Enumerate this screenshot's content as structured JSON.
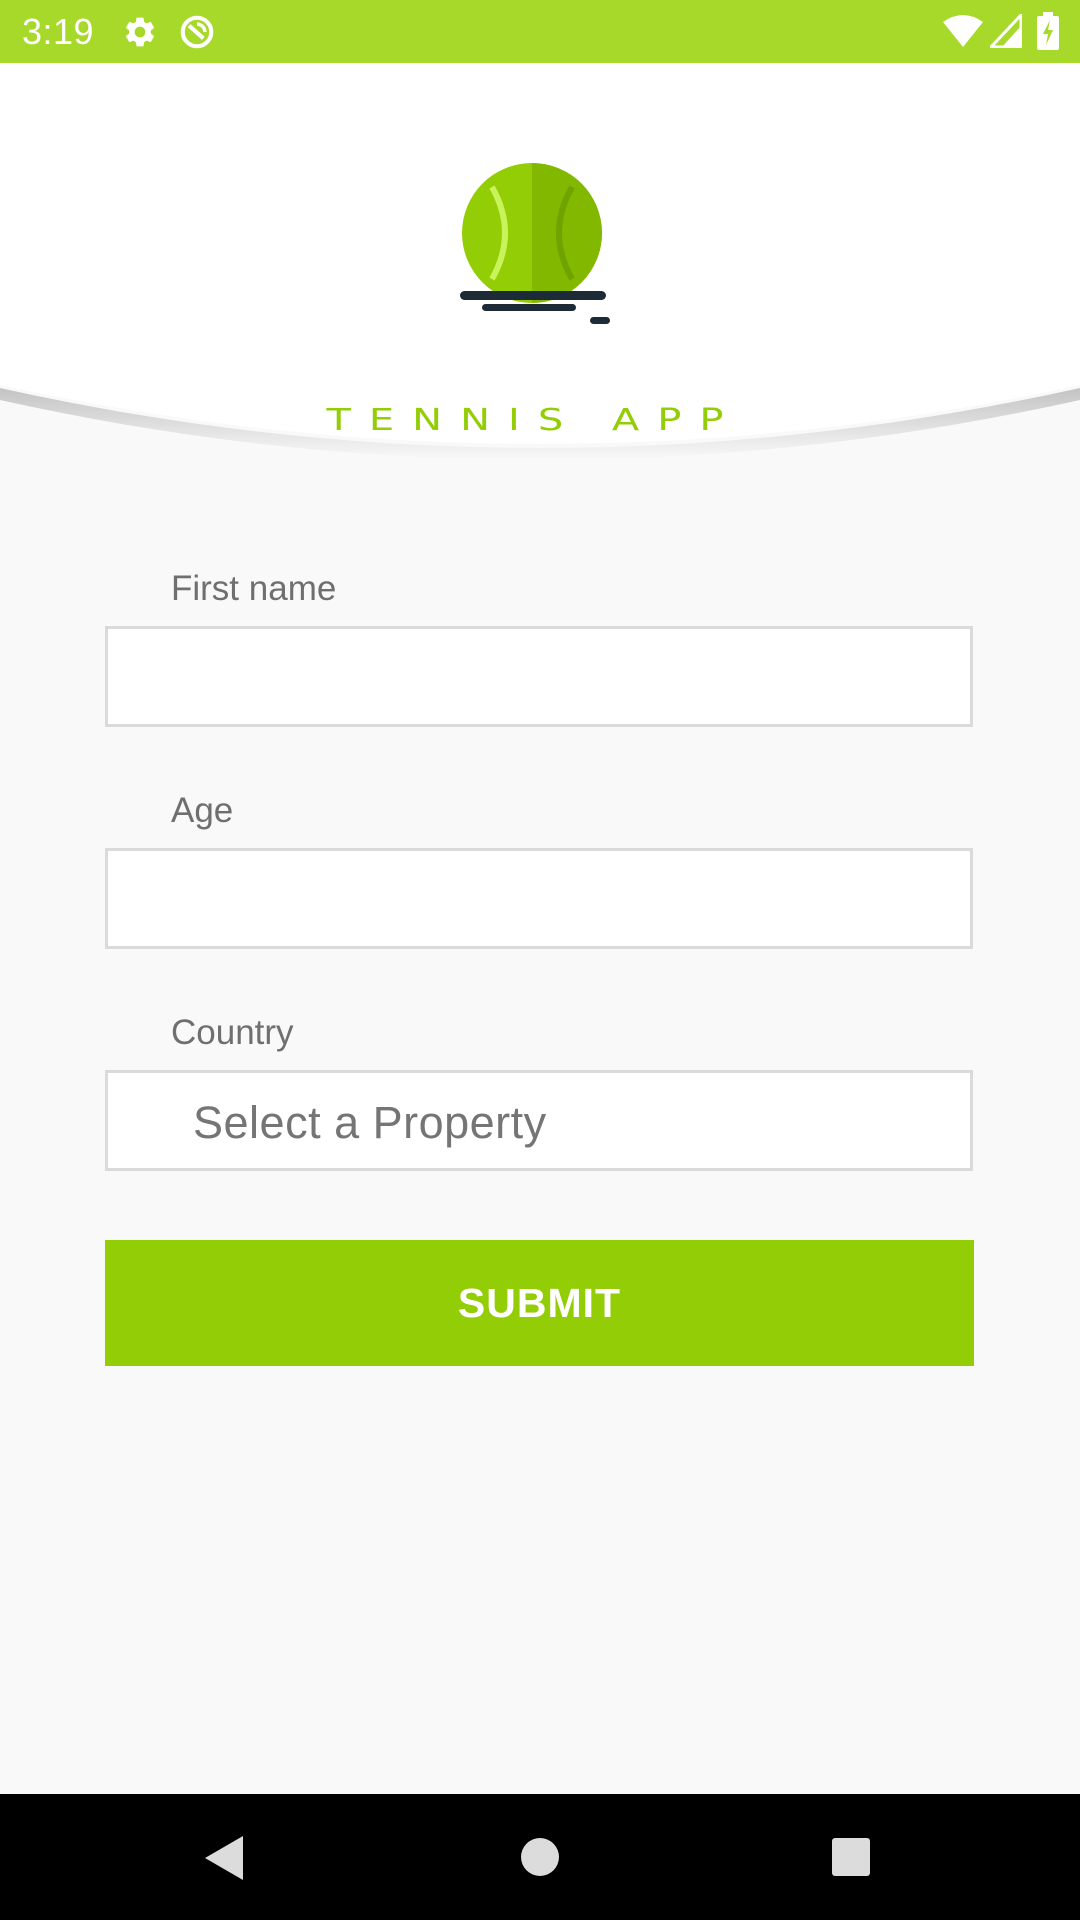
{
  "status_bar": {
    "time": "3:19",
    "background": "#a6d92a",
    "icons": [
      "gear-icon",
      "sync-icon",
      "wifi-icon",
      "signal-icon",
      "battery-icon"
    ]
  },
  "header": {
    "logo_text": "TENNIS APP",
    "accent_color": "#93cd05"
  },
  "form": {
    "first_name": {
      "label": "First name",
      "value": "",
      "placeholder": ""
    },
    "age": {
      "label": "Age",
      "value": "",
      "placeholder": ""
    },
    "country": {
      "label": "Country",
      "selected": "Select a Property"
    },
    "submit_label": "SUBMIT"
  },
  "nav_bar": {
    "icons": [
      "back-icon",
      "home-icon",
      "recents-icon"
    ]
  }
}
